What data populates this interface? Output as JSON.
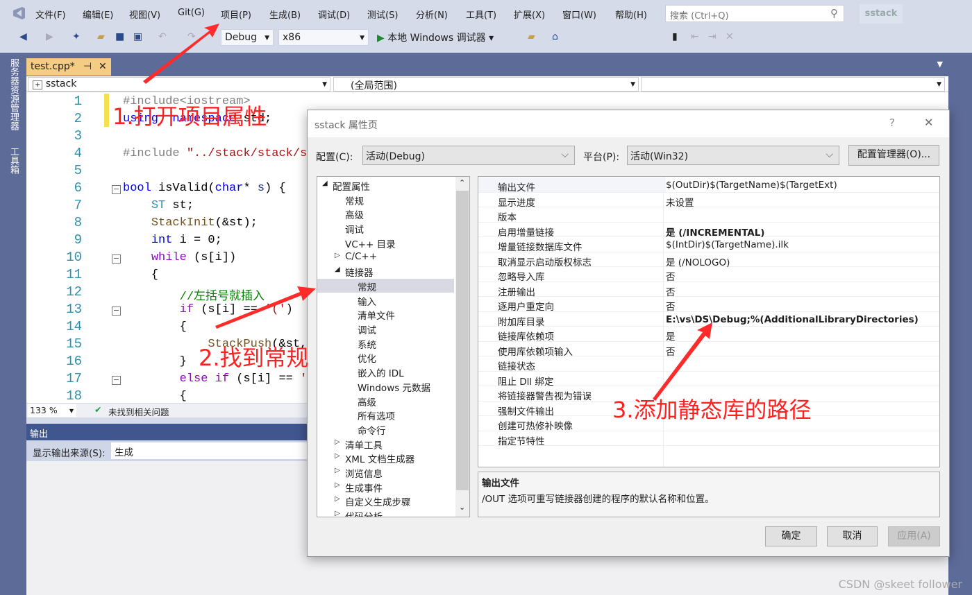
{
  "menu": [
    "文件(F)",
    "编辑(E)",
    "视图(V)",
    "Git(G)",
    "项目(P)",
    "生成(B)",
    "调试(D)",
    "测试(S)",
    "分析(N)",
    "工具(T)",
    "扩展(X)",
    "窗口(W)",
    "帮助(H)"
  ],
  "search": {
    "placeholder": "搜索 (Ctrl+Q)"
  },
  "project_name": "sstack",
  "toolbar": {
    "config": "Debug",
    "platform": "x86",
    "run": "本地 Windows 调试器"
  },
  "side_tabs": [
    "服务器资源管理器",
    "工具箱"
  ],
  "editor_tab": {
    "label": "test.cpp*",
    "pin": "⊣",
    "close": "✕"
  },
  "nav": {
    "project": "sstack",
    "scope": "(全局范围)"
  },
  "code": [
    [
      [
        "pp",
        "#include<iostream>"
      ]
    ],
    [
      [
        "kw",
        "using"
      ],
      [
        "",
        "  "
      ],
      [
        "kw",
        "namespace"
      ],
      [
        "",
        " std;"
      ]
    ],
    [],
    [
      [
        "pp",
        "#include "
      ],
      [
        "st",
        "\"../stack/stack/s"
      ]
    ],
    [],
    [
      [
        "kw",
        "bool"
      ],
      [
        "",
        " isValid("
      ],
      [
        "kw",
        "char"
      ],
      [
        "",
        "* "
      ],
      [
        "vr",
        "s"
      ],
      [
        "",
        ") {"
      ]
    ],
    [
      [
        "",
        "    "
      ],
      [
        "ty",
        "ST"
      ],
      [
        "",
        " st;"
      ]
    ],
    [
      [
        "",
        "    "
      ],
      [
        "fn",
        "StackInit"
      ],
      [
        "",
        "(&st);"
      ]
    ],
    [
      [
        "",
        "    "
      ],
      [
        "kw",
        "int"
      ],
      [
        "",
        " i = 0;"
      ]
    ],
    [
      [
        "",
        "    "
      ],
      [
        "kw2",
        "while"
      ],
      [
        "",
        " (s[i])"
      ]
    ],
    [
      [
        "",
        "    {"
      ]
    ],
    [
      [
        "",
        "        "
      ],
      [
        "cm",
        "//左括号就插入"
      ]
    ],
    [
      [
        "",
        "        "
      ],
      [
        "kw2",
        "if"
      ],
      [
        "",
        " (s[i] == "
      ],
      [
        "st",
        "'('"
      ],
      [
        "",
        ")"
      ]
    ],
    [
      [
        "",
        "        {"
      ]
    ],
    [
      [
        "",
        "            "
      ],
      [
        "fn",
        "StackPush"
      ],
      [
        "",
        "(&st,"
      ]
    ],
    [
      [
        "",
        "        }"
      ]
    ],
    [
      [
        "",
        "        "
      ],
      [
        "kw2",
        "else if"
      ],
      [
        "",
        " (s[i] == "
      ],
      [
        "st",
        "'"
      ]
    ],
    [
      [
        "",
        "        {"
      ]
    ]
  ],
  "status": {
    "zoom": "133 %",
    "issues": "未找到相关问题"
  },
  "output": {
    "title": "输出",
    "source_label": "显示输出来源(S):",
    "source_value": "生成"
  },
  "dialog": {
    "title": "sstack 属性页",
    "help": "?",
    "close": "✕",
    "config_label": "配置(C):",
    "config_value": "活动(Debug)",
    "platform_label": "平台(P):",
    "platform_value": "活动(Win32)",
    "config_manager": "配置管理器(O)...",
    "tree": [
      {
        "label": "配置属性",
        "level": 0,
        "expander": "◢"
      },
      {
        "label": "常规",
        "level": 1
      },
      {
        "label": "高级",
        "level": 1
      },
      {
        "label": "调试",
        "level": 1
      },
      {
        "label": "VC++ 目录",
        "level": 1
      },
      {
        "label": "C/C++",
        "level": 1,
        "expander": "▷"
      },
      {
        "label": "链接器",
        "level": 1,
        "expander": "◢"
      },
      {
        "label": "常规",
        "level": 2,
        "selected": true
      },
      {
        "label": "输入",
        "level": 2
      },
      {
        "label": "清单文件",
        "level": 2
      },
      {
        "label": "调试",
        "level": 2
      },
      {
        "label": "系统",
        "level": 2
      },
      {
        "label": "优化",
        "level": 2
      },
      {
        "label": "嵌入的 IDL",
        "level": 2
      },
      {
        "label": "Windows 元数据",
        "level": 2
      },
      {
        "label": "高级",
        "level": 2
      },
      {
        "label": "所有选项",
        "level": 2
      },
      {
        "label": "命令行",
        "level": 2
      },
      {
        "label": "清单工具",
        "level": 1,
        "expander": "▷"
      },
      {
        "label": "XML 文档生成器",
        "level": 1,
        "expander": "▷"
      },
      {
        "label": "浏览信息",
        "level": 1,
        "expander": "▷"
      },
      {
        "label": "生成事件",
        "level": 1,
        "expander": "▷"
      },
      {
        "label": "自定义生成步骤",
        "level": 1,
        "expander": "▷"
      },
      {
        "label": "代码分析",
        "level": 1,
        "expander": "▷"
      }
    ],
    "properties": [
      {
        "name": "输出文件",
        "value": "$(OutDir)$(TargetName)$(TargetExt)"
      },
      {
        "name": "显示进度",
        "value": "未设置"
      },
      {
        "name": "版本",
        "value": ""
      },
      {
        "name": "启用增量链接",
        "value": "是 (/INCREMENTAL)",
        "bold": true
      },
      {
        "name": "增量链接数据库文件",
        "value": "$(IntDir)$(TargetName).ilk"
      },
      {
        "name": "取消显示启动版权标志",
        "value": "是 (/NOLOGO)"
      },
      {
        "name": "忽略导入库",
        "value": "否"
      },
      {
        "name": "注册输出",
        "value": "否"
      },
      {
        "name": "逐用户重定向",
        "value": "否"
      },
      {
        "name": "附加库目录",
        "value": "E:\\vs\\DS\\Debug;%(AdditionalLibraryDirectories)",
        "bold": true
      },
      {
        "name": "链接库依赖项",
        "value": "是"
      },
      {
        "name": "使用库依赖项输入",
        "value": "否"
      },
      {
        "name": "链接状态",
        "value": ""
      },
      {
        "name": "阻止 Dll 绑定",
        "value": ""
      },
      {
        "name": "将链接器警告视为错误",
        "value": ""
      },
      {
        "name": "强制文件输出",
        "value": ""
      },
      {
        "name": "创建可热修补映像",
        "value": ""
      },
      {
        "name": "指定节特性",
        "value": ""
      }
    ],
    "desc_title": "输出文件",
    "desc_text": "/OUT 选项可重写链接器创建的程序的默认名称和位置。",
    "ok": "确定",
    "cancel": "取消",
    "apply": "应用(A)"
  },
  "annotations": [
    "1.打开项目属性",
    "2.找到常规",
    "3.添加静态库的路径"
  ],
  "annotation_color": "#ff2020",
  "watermark": "CSDN @skeet  follower"
}
